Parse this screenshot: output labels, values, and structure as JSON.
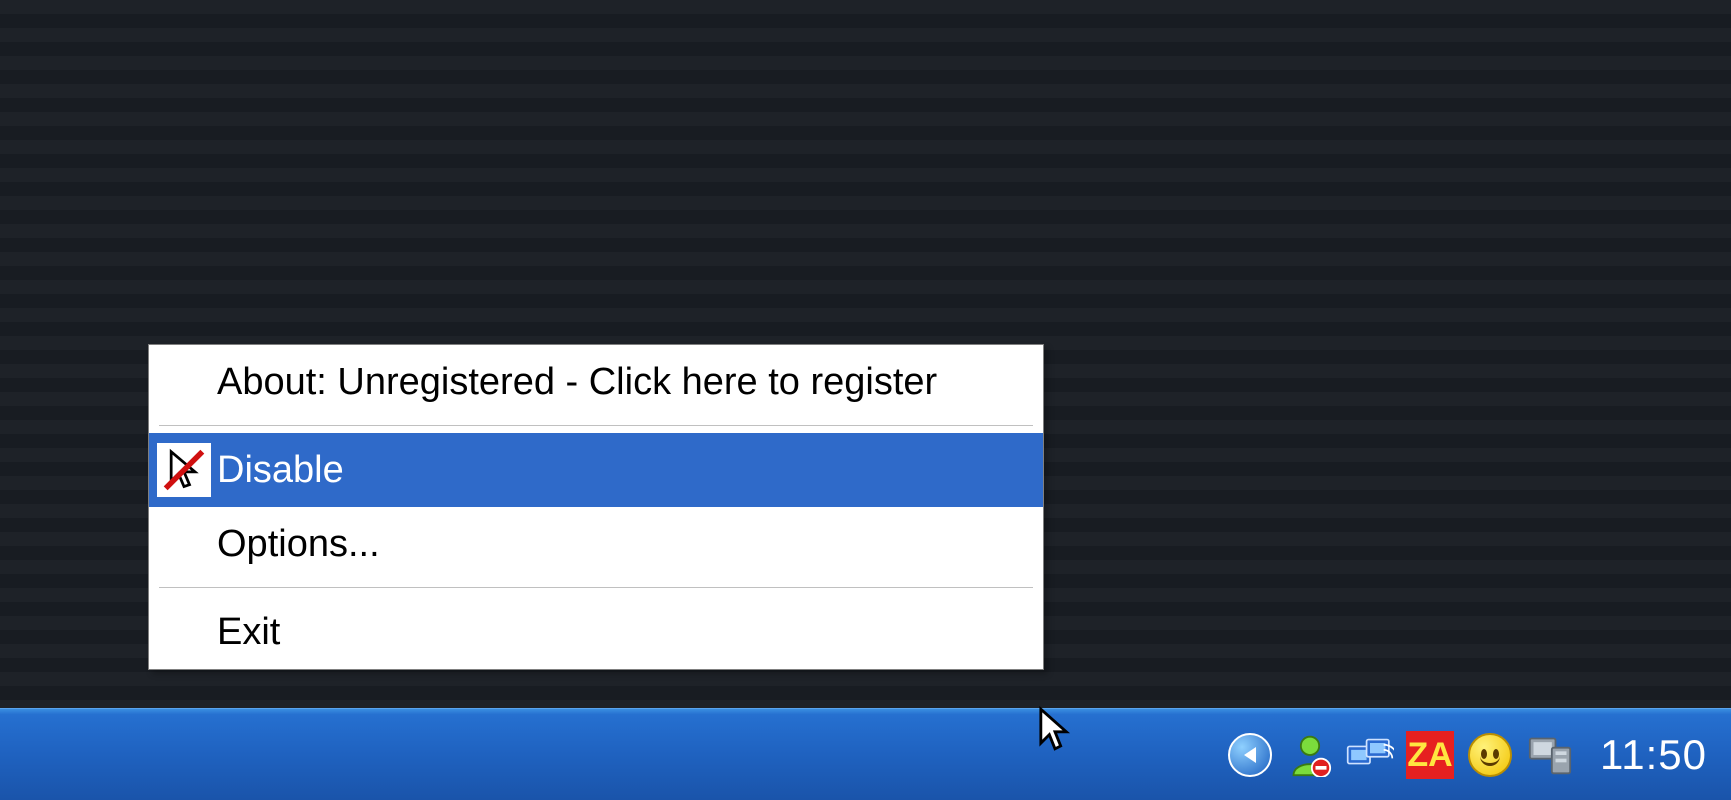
{
  "context_menu": {
    "items": [
      {
        "label": "About: Unregistered - Click here to register",
        "highlighted": false
      },
      {
        "label": "Disable",
        "highlighted": true
      },
      {
        "label": "Options...",
        "highlighted": false
      },
      {
        "label": "Exit",
        "highlighted": false
      }
    ]
  },
  "taskbar": {
    "clock": "11:50",
    "tray_icons": {
      "za_label": "ZA"
    }
  }
}
